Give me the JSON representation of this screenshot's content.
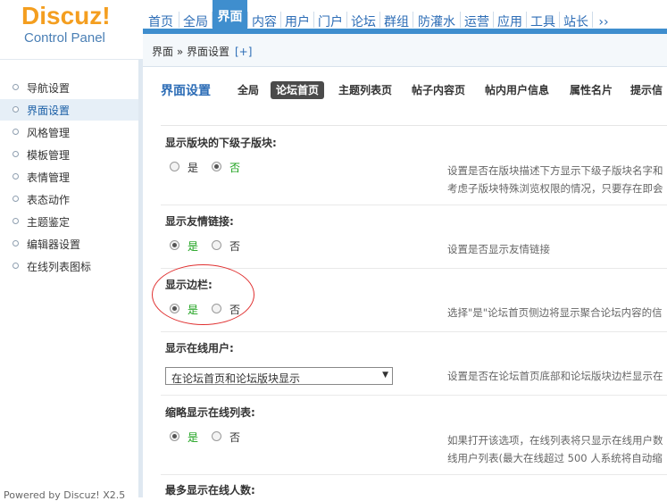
{
  "logo": {
    "name": "Discuz!",
    "subtitle": "Control Panel"
  },
  "nav": {
    "items": [
      "首页",
      "全局",
      "界面",
      "内容",
      "用户",
      "门户",
      "论坛",
      "群组",
      "防灌水",
      "运营",
      "应用",
      "工具",
      "站长",
      "››"
    ],
    "active_index": 2
  },
  "breadcrumb": {
    "path": "界面 » 界面设置",
    "add": "[+]"
  },
  "sidebar": {
    "items": [
      "导航设置",
      "界面设置",
      "风格管理",
      "模板管理",
      "表情管理",
      "表态动作",
      "主题鉴定",
      "编辑器设置",
      "在线列表图标"
    ],
    "active_index": 1,
    "footer": "Powered by Discuz! X2.5"
  },
  "tabs": {
    "title": "界面设置",
    "items": [
      "全局",
      "论坛首页",
      "主题列表页",
      "帖子内容页",
      "帖内用户信息",
      "属性名片",
      "提示信"
    ],
    "active_index": 1
  },
  "settings": [
    {
      "title": "显示版块的下级子版块:",
      "options": [
        "是",
        "否"
      ],
      "selected": 1,
      "desc": [
        "设置是否在版块描述下方显示下级子版块名字和",
        "考虑子版块特殊浏览权限的情况，只要存在即会"
      ]
    },
    {
      "title": "显示友情链接:",
      "options": [
        "是",
        "否"
      ],
      "selected": 0,
      "desc": [
        "设置是否显示友情链接"
      ]
    },
    {
      "title": "显示边栏:",
      "options": [
        "是",
        "否"
      ],
      "selected": 0,
      "desc": [
        "选择\"是\"论坛首页侧边将显示聚合论坛内容的信"
      ]
    },
    {
      "title": "显示在线用户:",
      "select_value": "在论坛首页和论坛版块显示",
      "desc": [
        "设置是否在论坛首页底部和论坛版块边栏显示在"
      ]
    },
    {
      "title": "缩略显示在线列表:",
      "options": [
        "是",
        "否"
      ],
      "selected": 0,
      "desc": [
        "如果打开该选项，在线列表将只显示在线用户数",
        "线用户列表(最大在线超过 500 人系统将自动缩"
      ]
    },
    {
      "title": "最多显示在线人数:"
    }
  ],
  "colors": {
    "accent": "#3f8ece",
    "link": "#2d6db6",
    "logo": "#f49e1f",
    "selected_option": "#19a019",
    "highlight_ring": "#e03030"
  }
}
